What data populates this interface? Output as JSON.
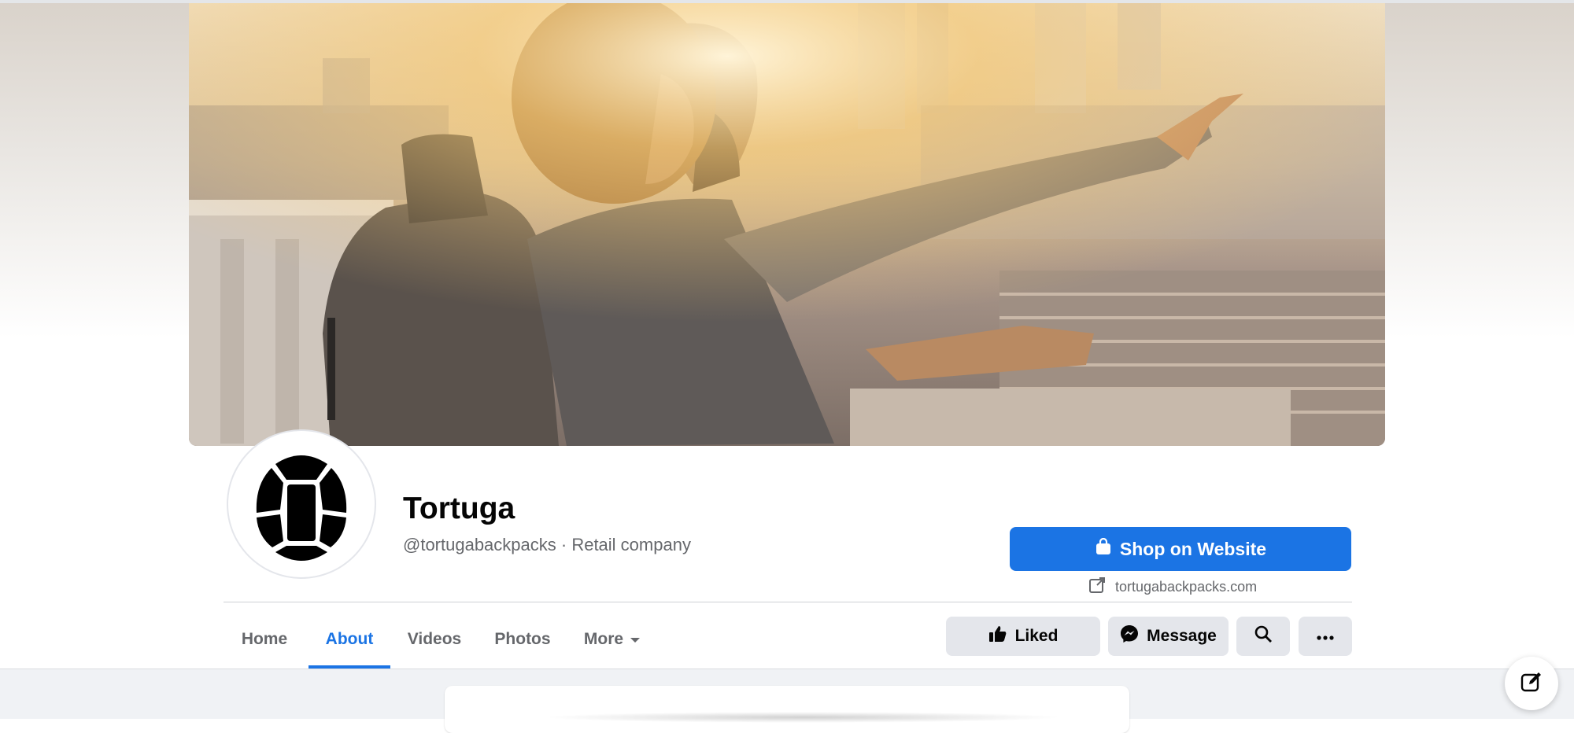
{
  "page": {
    "name": "Tortuga",
    "subtitle": "@tortugabackpacks · Retail company"
  },
  "cta": {
    "shop_label": "Shop on Website",
    "website": "tortugabackpacks.com"
  },
  "tabs": [
    {
      "label": "Home",
      "active": false
    },
    {
      "label": "About",
      "active": true
    },
    {
      "label": "Videos",
      "active": false
    },
    {
      "label": "Photos",
      "active": false
    },
    {
      "label": "More",
      "active": false
    }
  ],
  "actions": {
    "liked_label": "Liked",
    "message_label": "Message"
  },
  "icons": {
    "shop": "shopping-bag-icon",
    "external": "external-link-icon",
    "more_caret": "caret-down-icon",
    "like": "thumbs-up-icon",
    "messenger": "messenger-icon",
    "search": "search-icon",
    "ellipsis": "ellipsis-icon",
    "compose": "compose-icon"
  },
  "colors": {
    "accent": "#1b74e4",
    "secondary_button": "#e4e6eb",
    "muted_text": "#65676b",
    "page_background": "#f0f2f5"
  }
}
